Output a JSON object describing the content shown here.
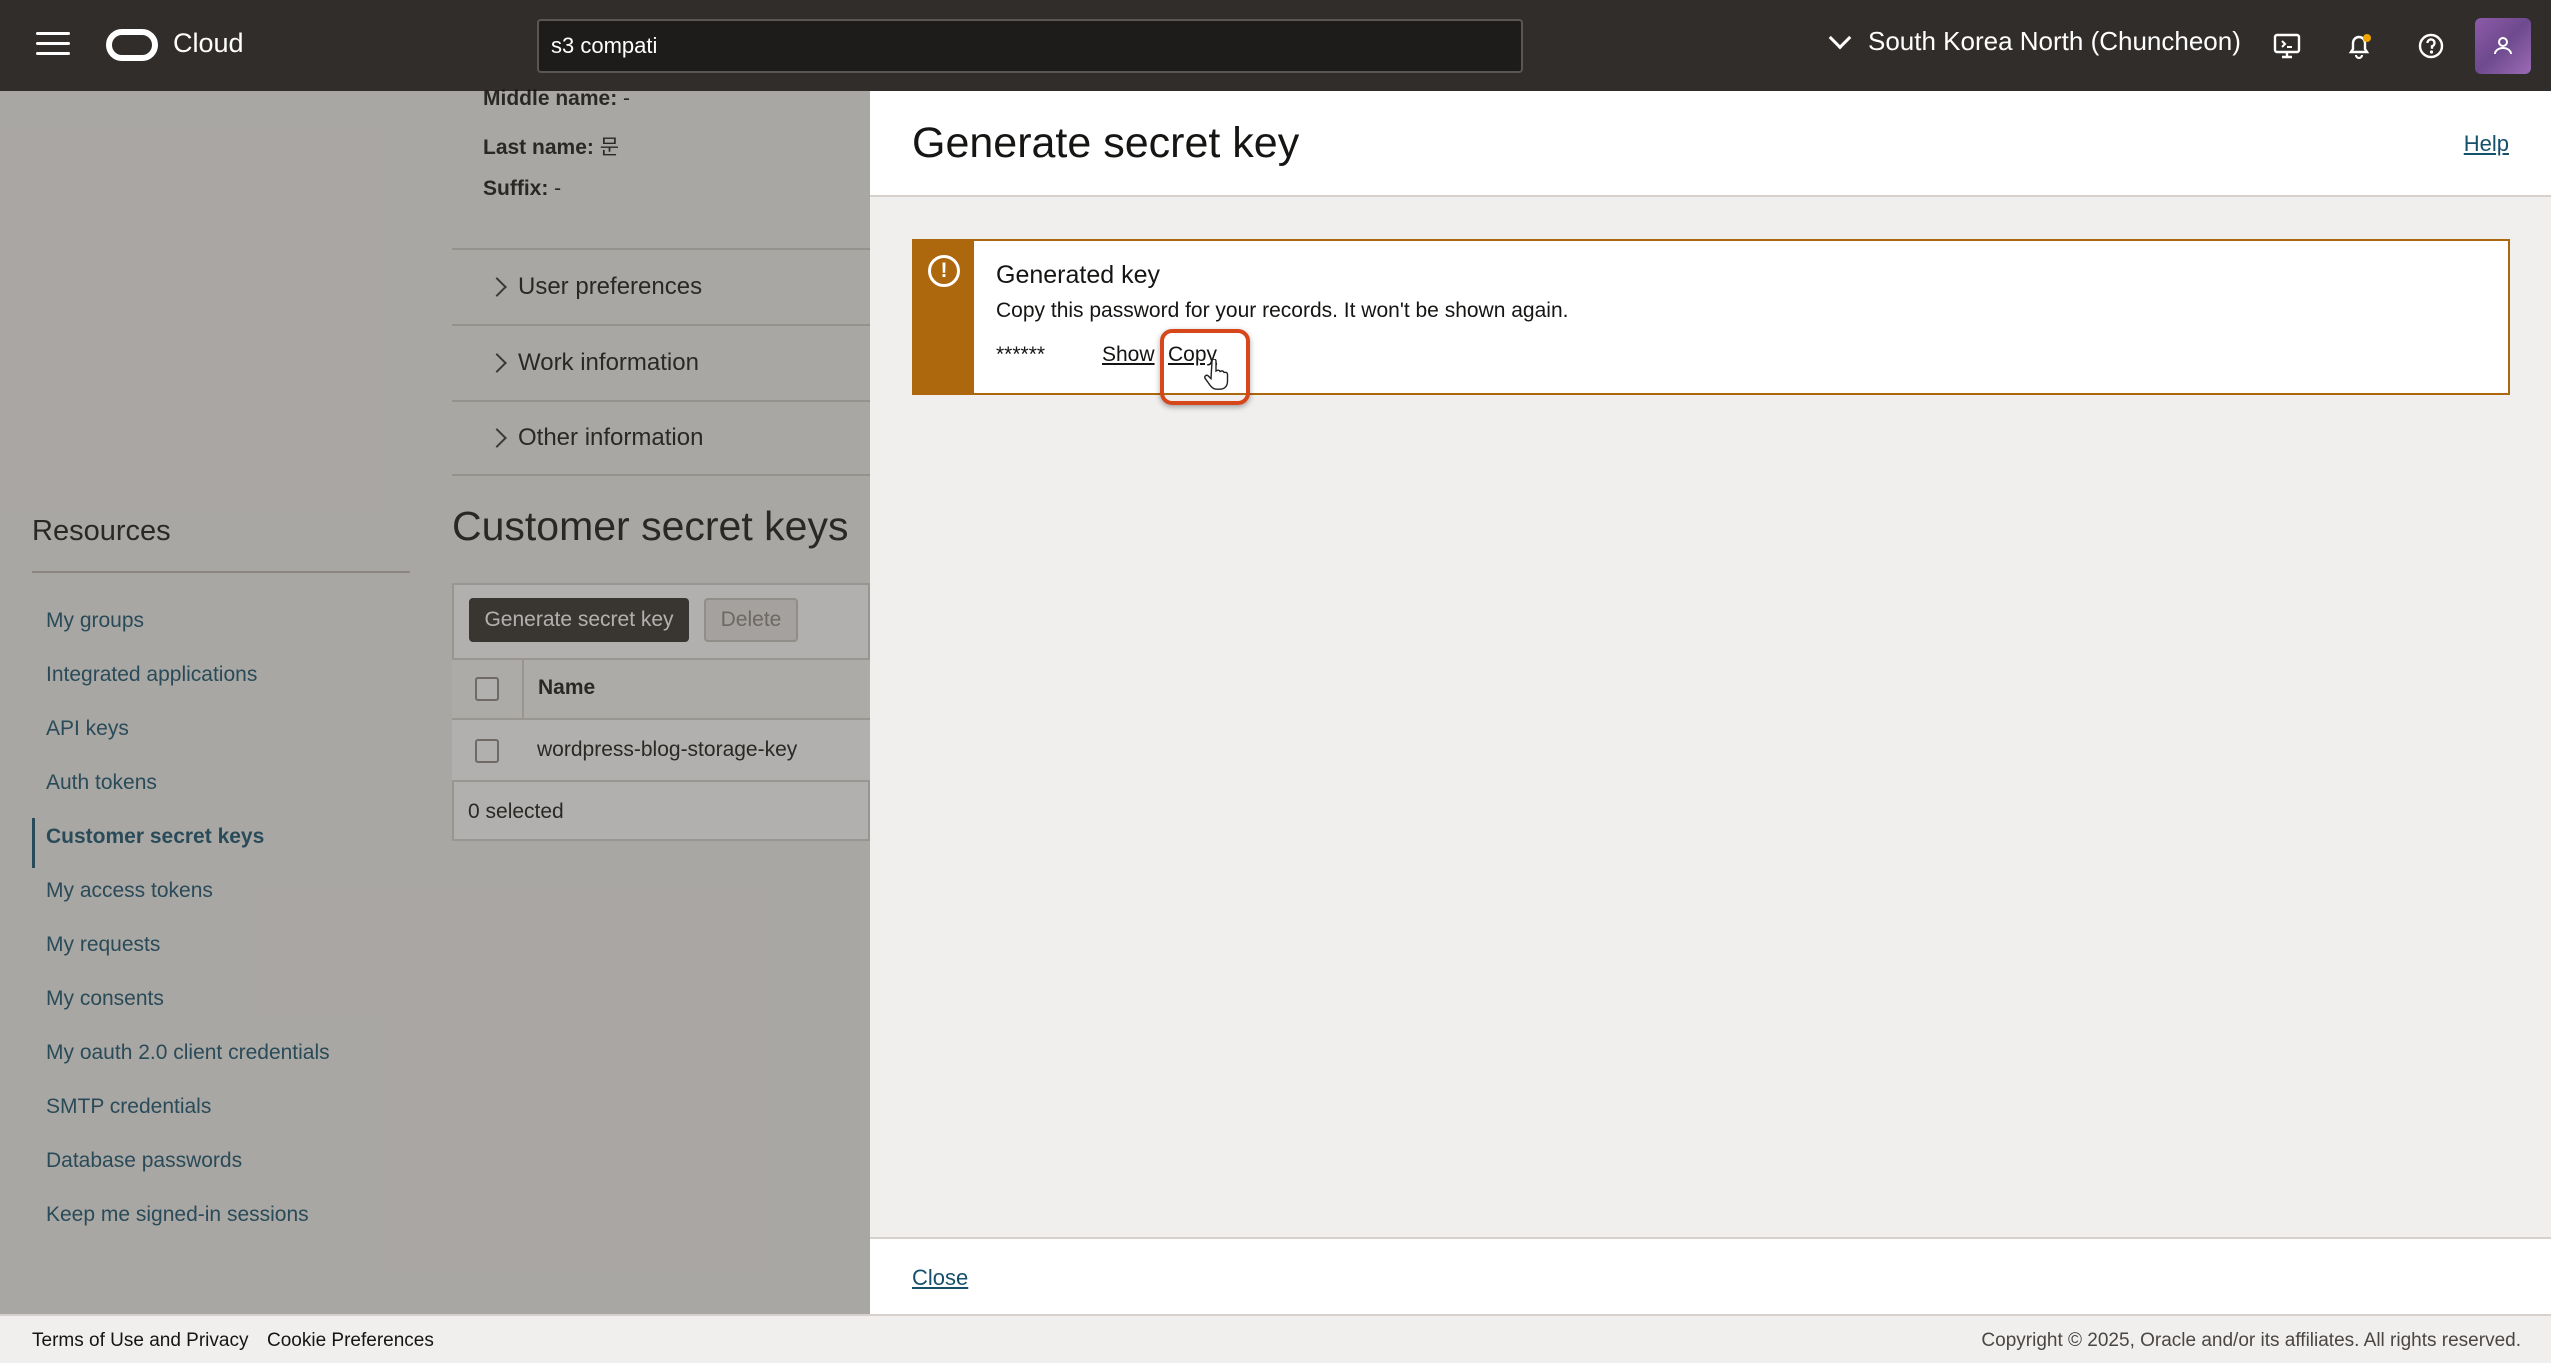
{
  "topbar": {
    "brand": "Cloud",
    "search_value": "s3 compati",
    "region": "South Korea North (Chuncheon)"
  },
  "profile": {
    "middle_name_label": "Middle name:",
    "middle_name_value": "-",
    "last_name_label": "Last name:",
    "last_name_value": "문",
    "suffix_label": "Suffix:",
    "suffix_value": "-"
  },
  "accordions": [
    "User preferences",
    "Work information",
    "Other information"
  ],
  "resources": {
    "title": "Resources",
    "items": [
      "My groups",
      "Integrated applications",
      "API keys",
      "Auth tokens",
      "Customer secret keys",
      "My access tokens",
      "My requests",
      "My consents",
      "My oauth 2.0 client credentials",
      "SMTP credentials",
      "Database passwords",
      "Keep me signed-in sessions"
    ],
    "active": "Customer secret keys"
  },
  "secret_keys": {
    "title": "Customer secret keys",
    "generate_label": "Generate secret key",
    "delete_label": "Delete",
    "column_name": "Name",
    "rows": [
      "wordpress-blog-storage-key"
    ],
    "selected_count": "0 selected"
  },
  "drawer": {
    "title": "Generate secret key",
    "help_label": "Help",
    "alert_title": "Generated key",
    "alert_text": "Copy this password for your records. It won't be shown again.",
    "masked_key": "******",
    "show_label": "Show",
    "copy_label": "Copy",
    "close_label": "Close"
  },
  "footer": {
    "terms": "Terms of Use and Privacy",
    "cookies": "Cookie Preferences",
    "copyright": "Copyright © 2025, Oracle and/or its affiliates. All rights reserved."
  },
  "colors": {
    "topbar": "#312d2a",
    "warning": "#ad670d",
    "link": "#16506b",
    "highlight": "#d6471b"
  }
}
